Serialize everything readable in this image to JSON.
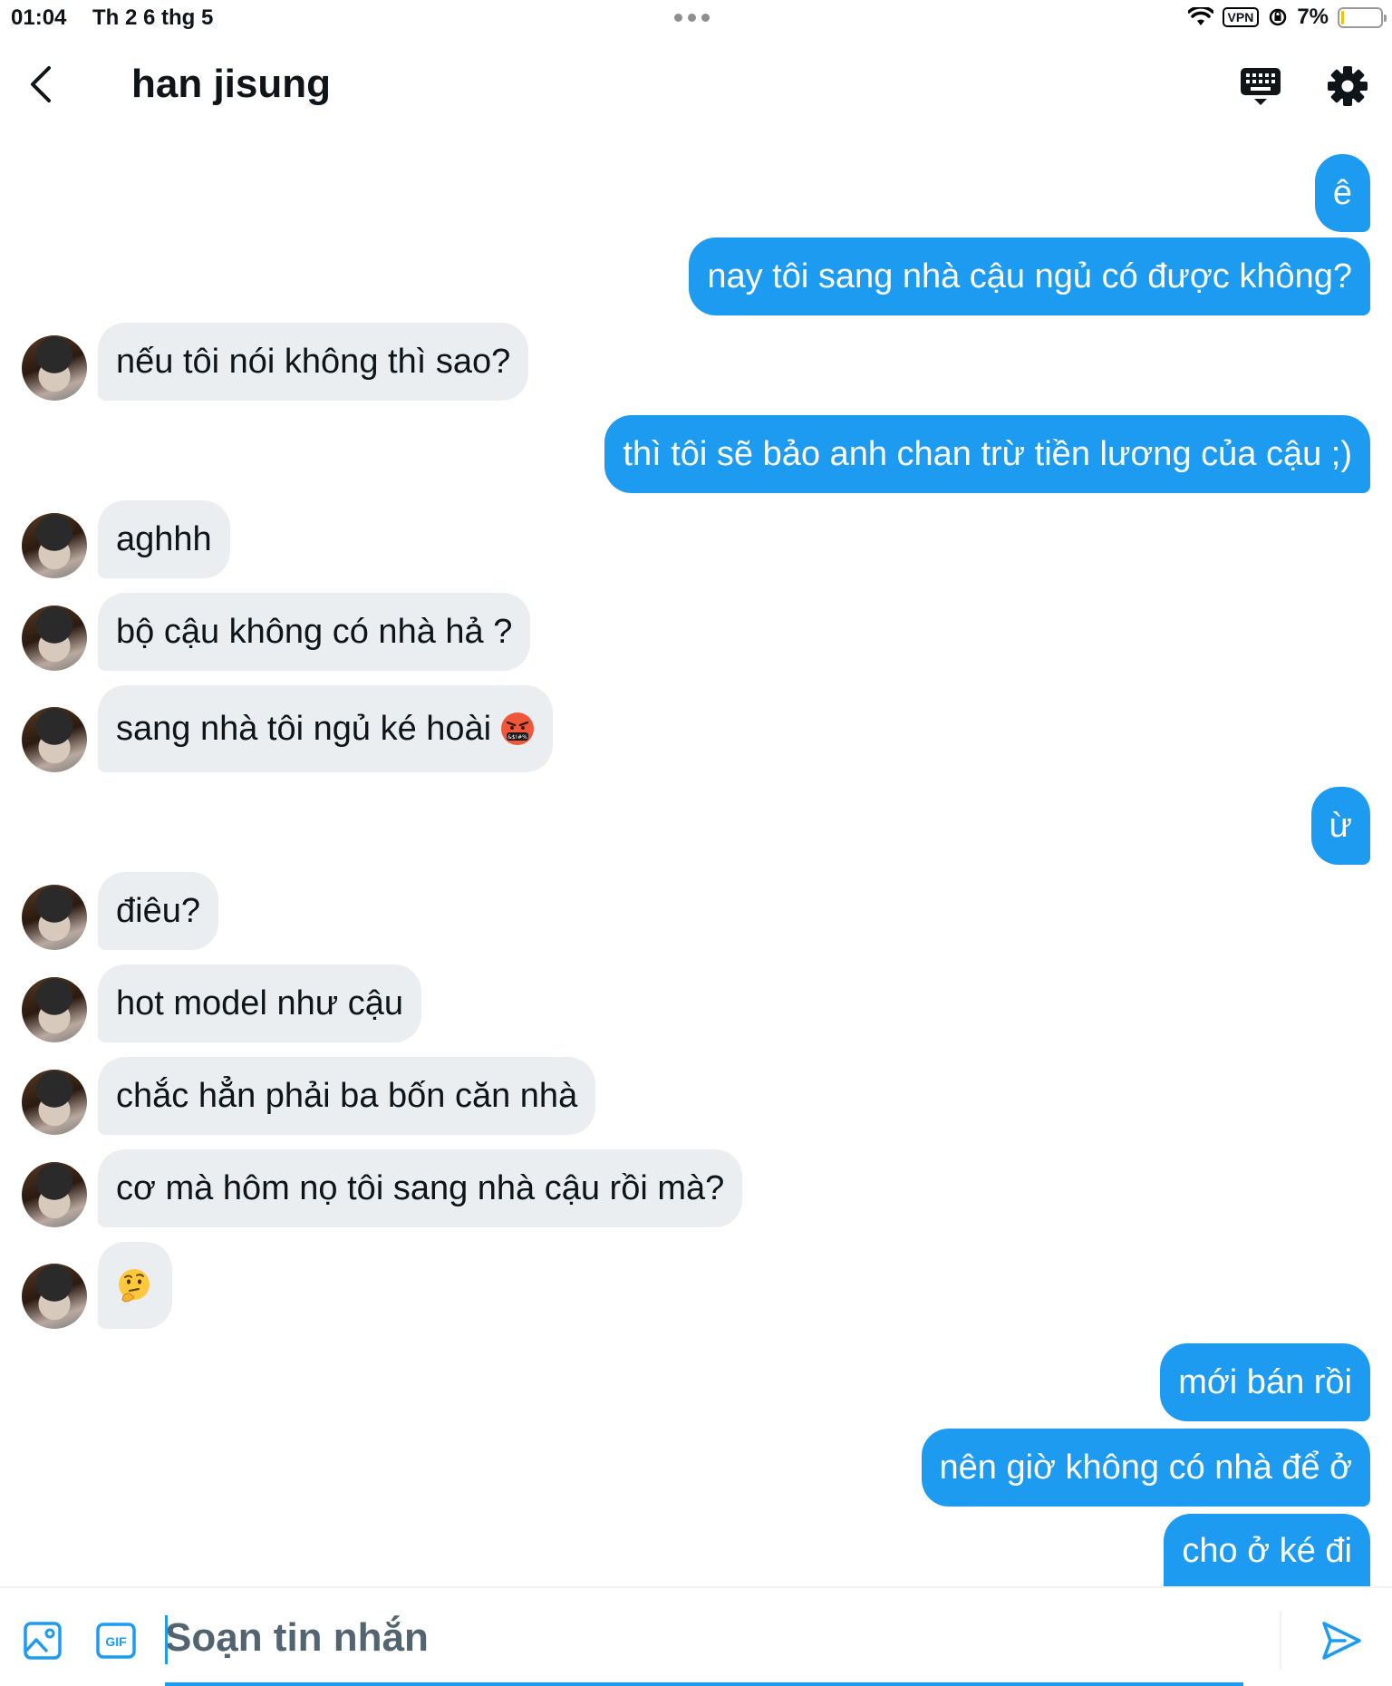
{
  "status_bar": {
    "time": "01:04",
    "date": "Th 2 6 thg 5",
    "vpn": "VPN",
    "battery": "7%",
    "battery_level": 0.07
  },
  "header": {
    "title": "han jisung",
    "icons": [
      "back-arrow-icon",
      "keyboard-icon",
      "gear-icon"
    ]
  },
  "messages": {
    "m1": "ê",
    "m2": "nay tôi sang nhà cậu ngủ có được không?",
    "m3": "nếu tôi nói không thì sao?",
    "m4": "thì tôi sẽ bảo anh chan trừ tiền lương của cậu ;)",
    "m5": "aghhh",
    "m6": "bộ cậu không có nhà hả ?",
    "m7": "sang nhà tôi ngủ ké hoài",
    "m8": "ừ",
    "m9": "điêu?",
    "m10": "hot model như cậu",
    "m11": "chắc hẳn phải ba bốn căn nhà",
    "m12": "cơ mà hôm nọ tôi sang nhà cậu rồi mà?",
    "m13_emoji": "thinking-face",
    "m14": "mới bán rồi",
    "m15": "nên giờ không có nhà để ở",
    "m16": "cho ở ké đi"
  },
  "composer": {
    "placeholder": "Soạn tin nhắn",
    "gif_label": "GIF"
  },
  "colors": {
    "sent_bubble": "#1d9bf0",
    "received_bubble": "#ebeef0",
    "accent": "#1d9bf0"
  }
}
